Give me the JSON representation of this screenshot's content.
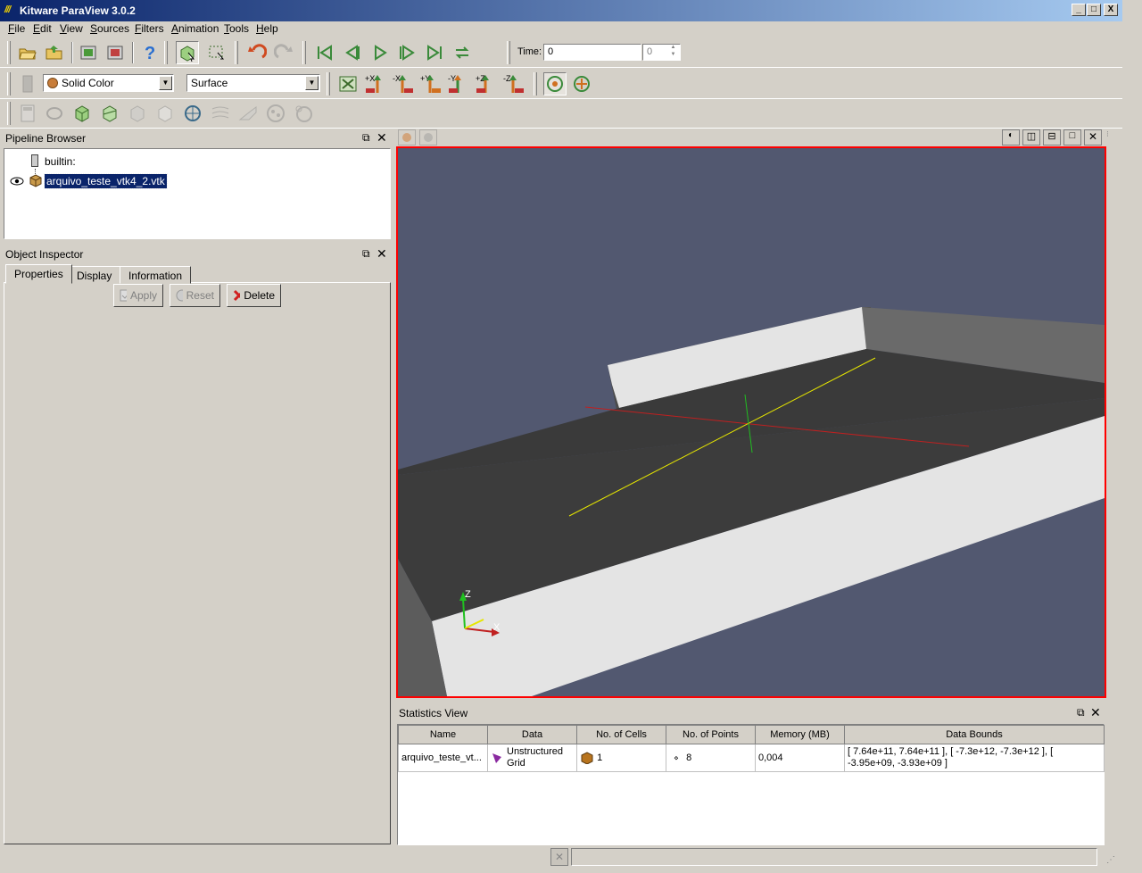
{
  "window": {
    "title": "Kitware ParaView 3.0.2",
    "logo": "///",
    "min": "_",
    "max": "□",
    "close": "X"
  },
  "menu": [
    "File",
    "Edit",
    "View",
    "Sources",
    "Filters",
    "Animation",
    "Tools",
    "Help"
  ],
  "toolbar1": {
    "time_label": "Time:",
    "time_value": "0",
    "time_index": "0"
  },
  "toolbar2": {
    "color_select": "Solid Color",
    "representation_select": "Surface",
    "axis_buttons": [
      "+X",
      "-X",
      "+Y",
      "-Y",
      "+Z",
      "-Z"
    ]
  },
  "pipeline_browser": {
    "title": "Pipeline Browser",
    "items": [
      {
        "label": "builtin:"
      },
      {
        "label": "arquivo_teste_vtk4_2.vtk"
      }
    ]
  },
  "object_inspector": {
    "title": "Object Inspector",
    "tabs": [
      "Properties",
      "Display",
      "Information"
    ],
    "buttons": {
      "apply": "Apply",
      "reset": "Reset",
      "delete": "Delete"
    }
  },
  "view": {
    "axes": {
      "z": "Z",
      "x": "X"
    }
  },
  "statistics": {
    "title": "Statistics View",
    "columns": [
      "Name",
      "Data",
      "No. of Cells",
      "No. of Points",
      "Memory (MB)",
      "Data Bounds"
    ],
    "row": {
      "name": "arquivo_teste_vt...",
      "data_line1": "Unstructured",
      "data_line2": "Grid",
      "cells": "1",
      "points": "8",
      "memory": "0,004",
      "bounds_line1": "[ 7.64e+11, 7.64e+11 ], [ -7.3e+12, -7.3e+12 ], [",
      "bounds_line2": "-3.95e+09, -3.93e+09 ]"
    }
  },
  "colors": {
    "titlebar_start": "#0a246a",
    "viewport_bg": "#525870",
    "active_view_border": "#ff0000"
  }
}
